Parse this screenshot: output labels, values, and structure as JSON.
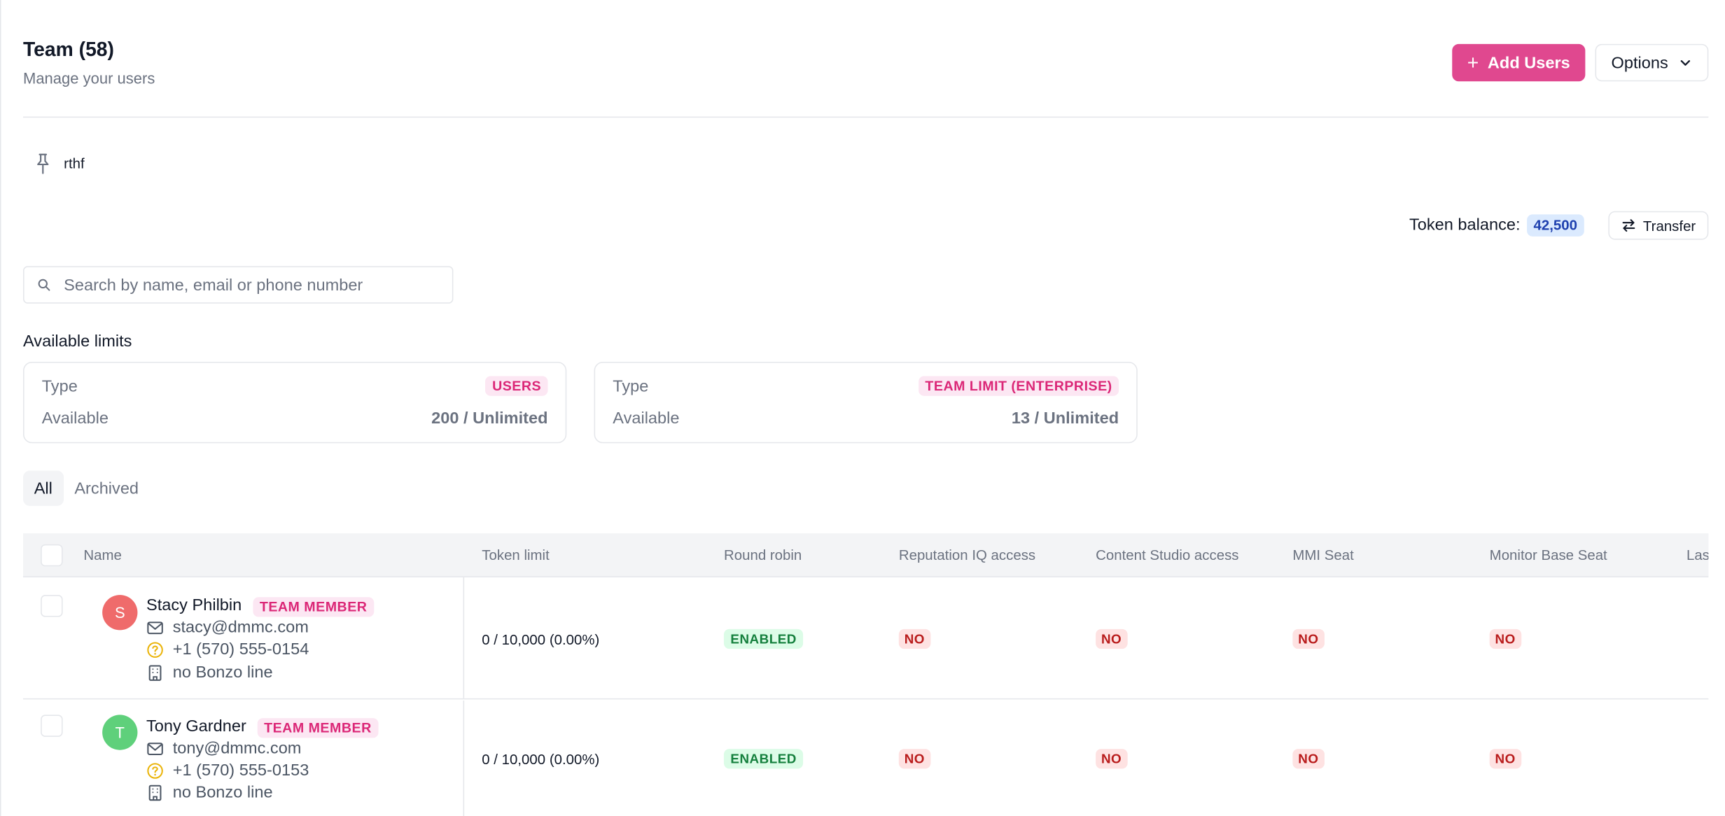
{
  "header": {
    "title": "Team (58)",
    "subtitle": "Manage your users",
    "add_users_label": "Add Users",
    "options_label": "Options"
  },
  "pinned": {
    "label": "rthf"
  },
  "token": {
    "label": "Token balance:",
    "value": "42,500",
    "transfer_label": "Transfer"
  },
  "search": {
    "placeholder": "Search by name, email or phone number"
  },
  "limits": {
    "title": "Available limits",
    "cards": [
      {
        "type_label": "Type",
        "type_value": "USERS",
        "available_label": "Available",
        "available_value": "200 / Unlimited"
      },
      {
        "type_label": "Type",
        "type_value": "TEAM LIMIT (ENTERPRISE)",
        "available_label": "Available",
        "available_value": "13 / Unlimited"
      }
    ]
  },
  "tabs": [
    {
      "label": "All",
      "active": true
    },
    {
      "label": "Archived",
      "active": false
    }
  ],
  "table": {
    "columns": [
      "Name",
      "Token limit",
      "Round robin",
      "Reputation IQ access",
      "Content Studio access",
      "MMI Seat",
      "Monitor Base Seat",
      "Las"
    ],
    "rows": [
      {
        "initial": "S",
        "avatar_color": "#ef6b6b",
        "name": "Stacy Philbin",
        "role": "TEAM MEMBER",
        "email": "stacy@dmmc.com",
        "phone": "+1 (570) 555-0154",
        "line": "no Bonzo line",
        "token_limit": "0 / 10,000 (0.00%)",
        "round_robin": "ENABLED",
        "reputation_iq": "NO",
        "content_studio": "NO",
        "mmi_seat": "NO",
        "monitor_base_seat": "NO"
      },
      {
        "initial": "T",
        "avatar_color": "#5fd07b",
        "name": "Tony Gardner",
        "role": "TEAM MEMBER",
        "email": "tony@dmmc.com",
        "phone": "+1 (570) 555-0153",
        "line": "no Bonzo line",
        "token_limit": "0 / 10,000 (0.00%)",
        "round_robin": "ENABLED",
        "reputation_iq": "NO",
        "content_studio": "NO",
        "mmi_seat": "NO",
        "monitor_base_seat": "NO"
      }
    ]
  },
  "colors": {
    "accent": "#e0488f",
    "badge_pink_bg": "#fce7f3",
    "badge_pink_text": "#db2777",
    "enabled_bg": "#dcfce7",
    "no_bg": "#fee2e2"
  }
}
